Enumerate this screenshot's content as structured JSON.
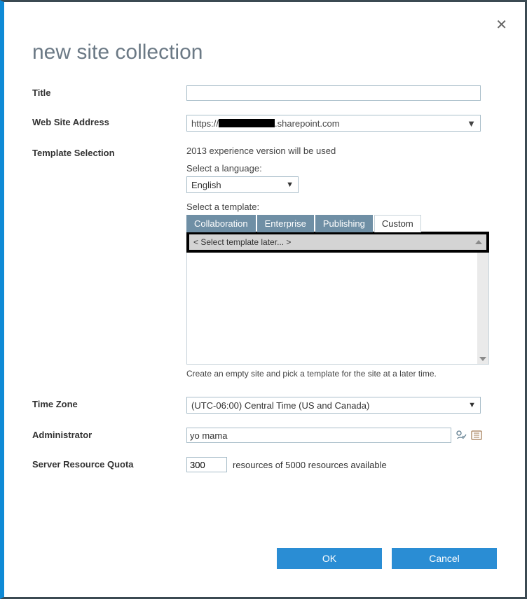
{
  "dialog": {
    "title": "new site collection",
    "close_glyph": "✕"
  },
  "fields": {
    "title": {
      "label": "Title",
      "value": ""
    },
    "address": {
      "label": "Web Site Address",
      "prefix": "https://",
      "suffix": ".sharepoint.com"
    },
    "template_selection": {
      "label": "Template Selection",
      "version_note": "2013 experience version will be used",
      "select_lang_label": "Select a language:",
      "language": "English",
      "select_template_label": "Select a template:",
      "tabs": [
        "Collaboration",
        "Enterprise",
        "Publishing",
        "Custom"
      ],
      "active_tab_index": 3,
      "selected_item": "< Select template later... >",
      "description": "Create an empty site and pick a template for the site at a later time."
    },
    "timezone": {
      "label": "Time Zone",
      "value": "(UTC-06:00) Central Time (US and Canada)"
    },
    "administrator": {
      "label": "Administrator",
      "value": "yo mama"
    },
    "quota": {
      "label": "Server Resource Quota",
      "value": "300",
      "suffix": "resources of 5000 resources available"
    }
  },
  "buttons": {
    "ok": "OK",
    "cancel": "Cancel"
  }
}
